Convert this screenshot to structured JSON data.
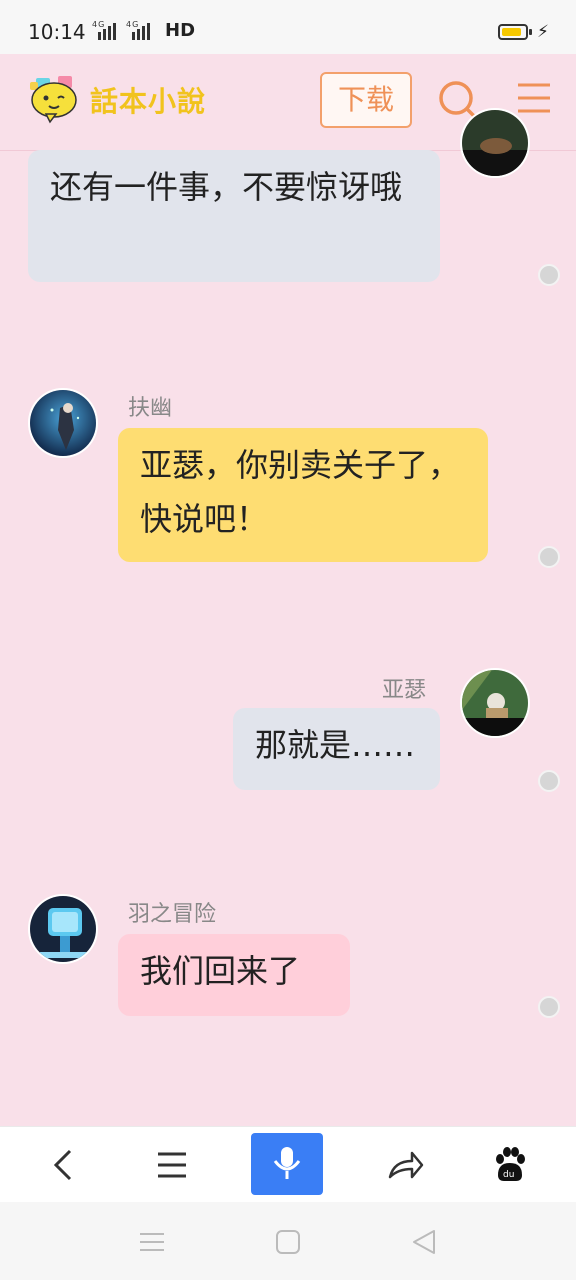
{
  "status_bar": {
    "time": "10:14",
    "network": "4G",
    "hd": "HD",
    "battery_level": 0.85,
    "battery_color": "#f6c800"
  },
  "header": {
    "logo_text": "話本小說",
    "download_label": "下载",
    "icons": [
      "search-icon",
      "menu-icon"
    ],
    "accent_color": "#ef9157"
  },
  "messages": [
    {
      "speaker": "",
      "text": "还有一件事，不要惊讶哦",
      "side": "left",
      "color": "#e1e4ec"
    },
    {
      "speaker": "扶幽",
      "text": "亚瑟，你别卖关子了，快说吧！",
      "side": "left",
      "color": "#fedd72"
    },
    {
      "speaker": "亚瑟",
      "text": "那就是……",
      "side": "right",
      "color": "#e1e4ec"
    },
    {
      "speaker": "羽之冒险",
      "text": "我们回来了",
      "side": "left",
      "color": "#ffcfda"
    }
  ],
  "toolbar": {
    "icons": [
      "back-icon",
      "menu-lines-icon",
      "microphone-icon",
      "share-icon",
      "baidu-paw-icon"
    ],
    "voice_color": "#3a7ef5"
  },
  "nav_bar": {
    "icons": [
      "recent-apps-icon",
      "home-icon",
      "back-triangle-icon"
    ]
  }
}
